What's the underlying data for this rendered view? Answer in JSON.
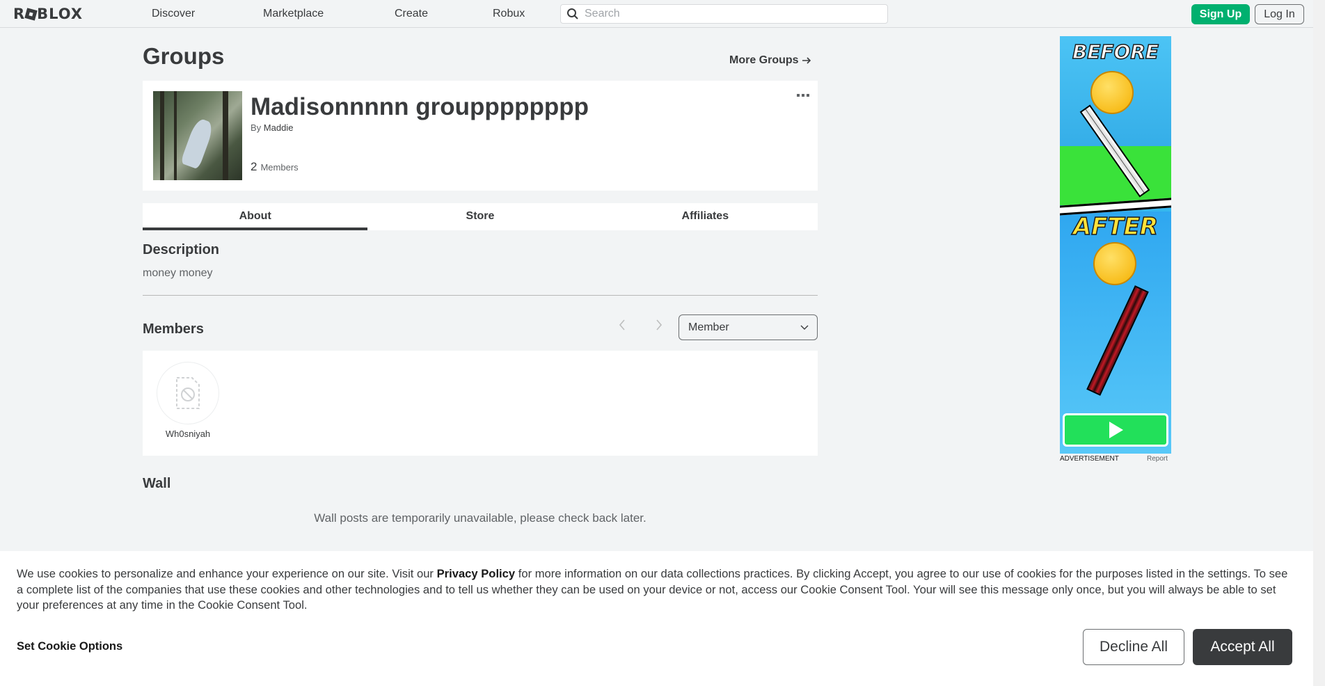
{
  "nav": {
    "logo": "ROBLOX",
    "links": [
      "Discover",
      "Marketplace",
      "Create",
      "Robux"
    ],
    "search_placeholder": "Search",
    "signup": "Sign Up",
    "login": "Log In"
  },
  "page": {
    "title": "Groups",
    "more_groups": "More Groups"
  },
  "group": {
    "name": "Madisonnnnn groupppppppp",
    "by_label": "By",
    "owner": "Maddie",
    "member_count": "2",
    "members_label": "Members",
    "more_icon": "more-dots-icon"
  },
  "tabs": [
    "About",
    "Store",
    "Affiliates"
  ],
  "active_tab": "About",
  "description": {
    "title": "Description",
    "text": "money money"
  },
  "members": {
    "title": "Members",
    "role_selected": "Member",
    "list": [
      {
        "name": "Wh0sniyah",
        "avatar": "blocked-avatar-icon"
      }
    ]
  },
  "wall": {
    "title": "Wall",
    "message": "Wall posts are temporarily unavailable, please check back later."
  },
  "ad": {
    "before_text": "BEFORE",
    "after_text": "AFTER",
    "label": "ADVERTISEMENT",
    "report": "Report"
  },
  "cookie": {
    "text_1": "We use cookies to personalize and enhance your experience on our site. Visit our ",
    "privacy_link": "Privacy Policy",
    "text_2": " for more information on our data collections practices. By clicking Accept, you agree to our use of cookies for the purposes listed in the settings. To see a complete list of the companies that use these cookies and other technologies and to tell us whether they can be used on your device or not, access our Cookie Consent Tool. Your will see this message only once, but you will always be able to set your preferences at any time in the Cookie Consent Tool.",
    "options": "Set Cookie Options",
    "decline": "Decline All",
    "accept": "Accept All"
  },
  "colors": {
    "signup_green": "#00b06f",
    "page_bg": "#f2f4f5",
    "text_primary": "#393b3d",
    "accept_dark": "#393b3d"
  }
}
